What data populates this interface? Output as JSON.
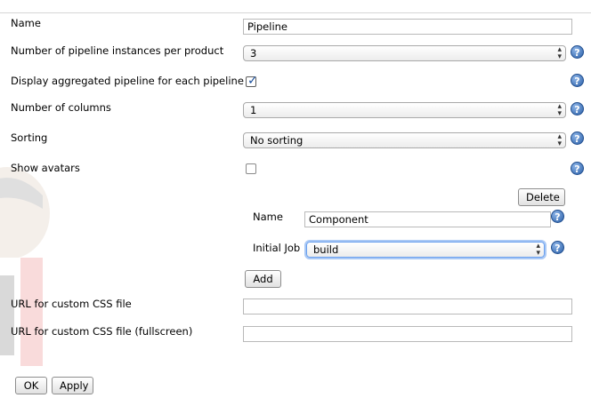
{
  "form": {
    "name_label": "Name",
    "name_value": "Pipeline",
    "instances_label": "Number of pipeline instances per product",
    "instances_value": "3",
    "aggregated_label": "Display aggregated pipeline for each pipeline",
    "aggregated_checked": true,
    "columns_label": "Number of columns",
    "columns_value": "1",
    "sorting_label": "Sorting",
    "sorting_value": "No sorting",
    "avatars_label": "Show avatars",
    "avatars_checked": false,
    "css_label": "URL for custom CSS file",
    "css_value": "",
    "css_fullscreen_label": "URL for custom CSS file (fullscreen)",
    "css_fullscreen_value": ""
  },
  "component": {
    "delete_label": "Delete",
    "name_label": "Name",
    "name_value": "Component",
    "initial_job_label": "Initial Job",
    "initial_job_value": "build",
    "add_label": "Add"
  },
  "footer": {
    "ok_label": "OK",
    "apply_label": "Apply"
  },
  "icons": {
    "help": "help-icon",
    "dropdown": "chevron-updown-icon"
  },
  "colors": {
    "help_blue": "#2a5fa8",
    "focus_ring": "#a9c8f5"
  }
}
